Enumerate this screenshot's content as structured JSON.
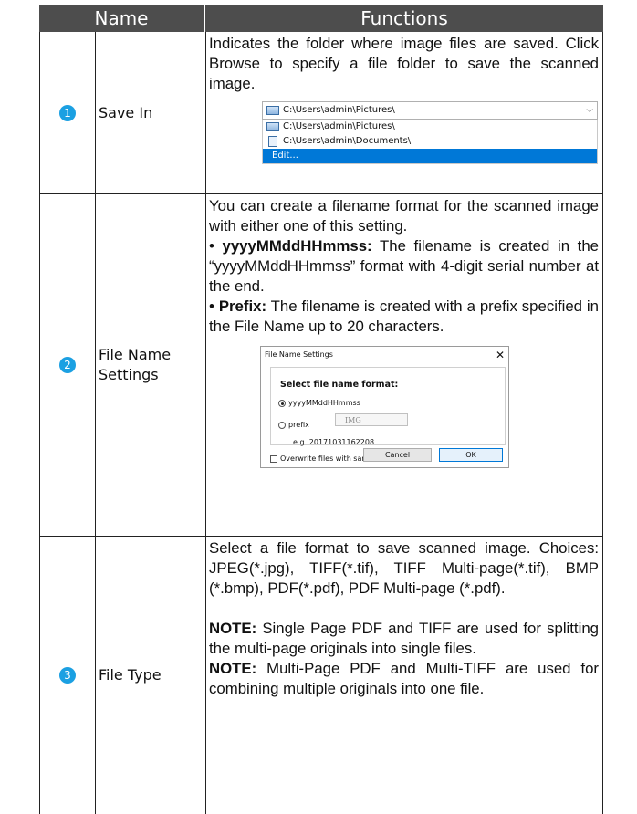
{
  "header": {
    "col_name": "Name",
    "col_functions": "Functions"
  },
  "rows": [
    {
      "num": "1",
      "name": "Save In",
      "text": "Indicates the folder where image files are saved. Click Browse to specify a file folder to save the scanned image.",
      "dropdown": {
        "selected": "C:\\Users\\admin\\Pictures\\",
        "options": [
          "C:\\Users\\admin\\Pictures\\",
          "C:\\Users\\admin\\Documents\\",
          "Edit..."
        ]
      }
    },
    {
      "num": "2",
      "name": "File Name Settings",
      "intro": "You can create a filename format for the scanned image with either one of this setting.",
      "b1_label": "yyyyMMddHHmmss:",
      "b1_text": " The filename is created in the “yyyyMMddHHmmss” format with 4-digit serial number at the end.",
      "b2_label": "Prefix:",
      "b2_text": " The filename is created with a prefix specified in the File Name up to 20 characters.",
      "dialog": {
        "title": "File Name Settings",
        "group_label": "Select file name format:",
        "opt1": "yyyyMMddHHmmss",
        "opt2": "prefix",
        "prefix_value": "IMG",
        "example": "e.g.:20171031162208",
        "overwrite": "Overwrite files with same name",
        "cancel": "Cancel",
        "ok": "OK"
      }
    },
    {
      "num": "3",
      "name": "File Type",
      "text": "Select a file format to save scanned image. Choices: JPEG(*.jpg), TIFF(*.tif), TIFF Multi-page(*.tif), BMP (*.bmp), PDF(*.pdf), PDF Multi-page (*.pdf).",
      "note_label": "NOTE:",
      "note1": " Single Page PDF and TIFF are used for splitting the multi-page originals into single files.",
      "note2": " Multi-Page PDF and Multi-TIFF are used for combining multiple originals into one file."
    }
  ],
  "colors": {
    "header_bg": "#4d4d4d",
    "badge": "#1ba0e2",
    "selection": "#0078d7"
  }
}
